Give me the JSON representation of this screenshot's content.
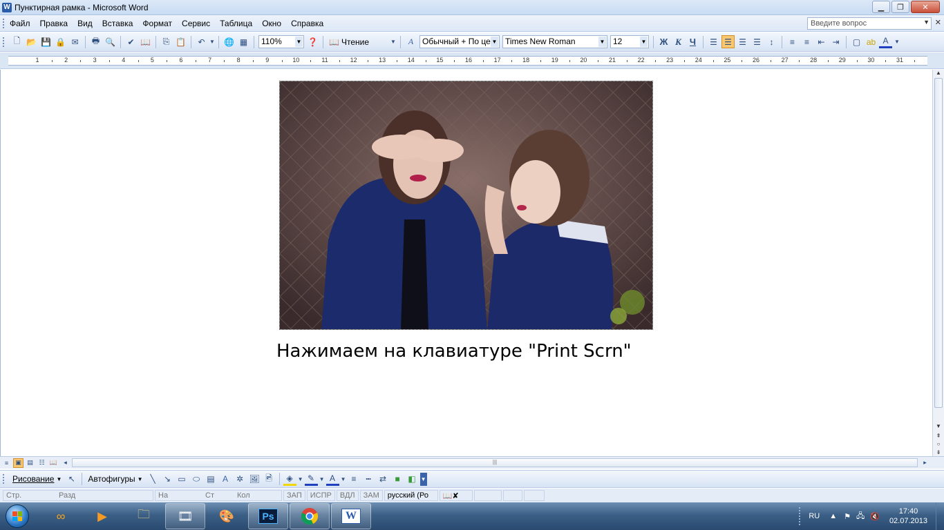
{
  "window": {
    "title": "Пунктирная рамка - Microsoft Word",
    "app_icon": "W",
    "controls": [
      "minimize-icon",
      "maximize-icon",
      "close-icon"
    ]
  },
  "menu": {
    "items": [
      "Файл",
      "Правка",
      "Вид",
      "Вставка",
      "Формат",
      "Сервис",
      "Таблица",
      "Окно",
      "Справка"
    ],
    "help_placeholder": "Введите вопрос"
  },
  "toolbar": {
    "zoom": "110%",
    "reading_label": "Чтение",
    "style": "Обычный + По це",
    "font": "Times New Roman",
    "size": "12",
    "bold": "Ж",
    "italic": "К",
    "underline": "Ч"
  },
  "ruler": {
    "numbers": [
      "1",
      "2",
      "3",
      "4",
      "5",
      "6",
      "7",
      "8",
      "9",
      "10",
      "11",
      "12",
      "13",
      "14",
      "15",
      "16",
      "17",
      "18",
      "19",
      "20",
      "21",
      "22",
      "23",
      "24",
      "25",
      "26",
      "27",
      "28",
      "29",
      "30",
      "31"
    ]
  },
  "document": {
    "caption": "Нажимаем на клавиатуре \"Print Scrn\"",
    "image_alt": "photo of two girls, one covering the other's eyes"
  },
  "drawing_toolbar": {
    "drawing_label": "Рисование",
    "autoshapes_label": "Автофигуры"
  },
  "statusbar": {
    "page": "Стр.",
    "section": "Разд",
    "at": "На",
    "line": "Ст",
    "column": "Кол",
    "rec": "ЗАП",
    "trk": "ИСПР",
    "ext": "ВДЛ",
    "ovr": "ЗАМ",
    "language": "русский (Ро"
  },
  "taskbar": {
    "apps": [
      "windows-start",
      "ie-like-app",
      "media-player",
      "explorer",
      "film-app",
      "paint",
      "photoshop",
      "chrome",
      "word"
    ],
    "photoshop_label": "Ps",
    "word_label": "W",
    "lang": "RU",
    "time": "17:40",
    "date": "02.07.2013"
  }
}
